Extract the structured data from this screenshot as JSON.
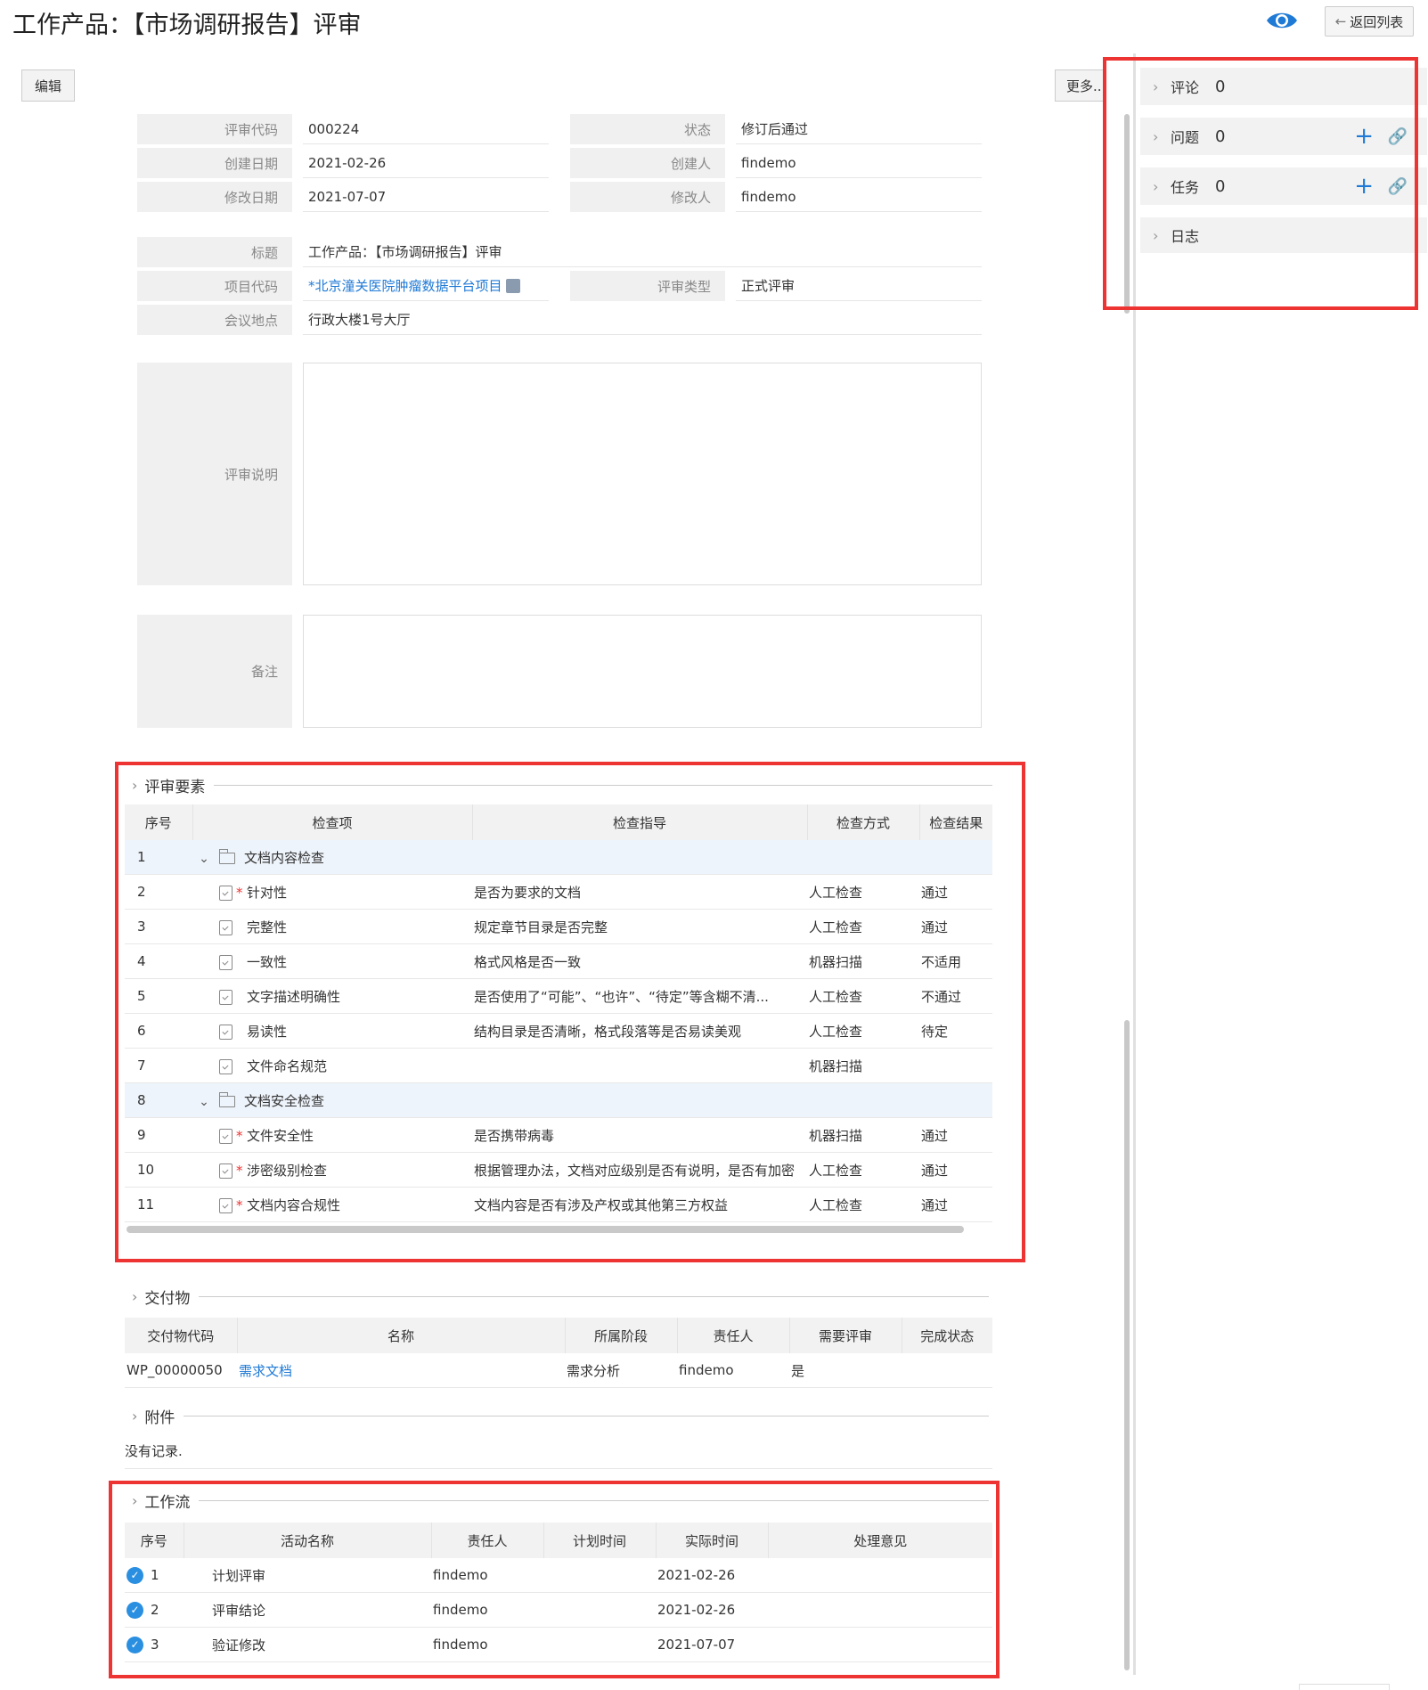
{
  "page_title": "工作产品：【市场调研报告】评审",
  "header": {
    "back_label": "返回列表",
    "eye_icon": "eye-icon"
  },
  "toolbar": {
    "edit_label": "编辑",
    "more_label": "更多..."
  },
  "form": {
    "review_code_label": "评审代码",
    "review_code": "000224",
    "status_label": "状态",
    "status": "修订后通过",
    "created_date_label": "创建日期",
    "created_date": "2021-02-26",
    "creator_label": "创建人",
    "creator": "findemo",
    "modified_date_label": "修改日期",
    "modified_date": "2021-07-07",
    "modifier_label": "修改人",
    "modifier": "findemo",
    "title_label": "标题",
    "title": "工作产品：【市场调研报告】评审",
    "project_code_label": "项目代码",
    "project_code": "*北京潼关医院肿瘤数据平台项目",
    "review_type_label": "评审类型",
    "review_type": "正式评审",
    "location_label": "会议地点",
    "location": "行政大楼1号大厅",
    "description_label": "评审说明",
    "description": "",
    "remark_label": "备注",
    "remark": ""
  },
  "review_elements": {
    "section_title": "评审要素",
    "headers": [
      "序号",
      "检查项",
      "检查指导",
      "检查方式",
      "检查结果"
    ],
    "rows": [
      {
        "no": "1",
        "group": true,
        "item": "文档内容检查",
        "required": false,
        "guide": "",
        "method": "",
        "result": ""
      },
      {
        "no": "2",
        "group": false,
        "item": "针对性",
        "required": true,
        "guide": "是否为要求的文档",
        "method": "人工检查",
        "result": "通过"
      },
      {
        "no": "3",
        "group": false,
        "item": "完整性",
        "required": false,
        "guide": "规定章节目录是否完整",
        "method": "人工检查",
        "result": "通过"
      },
      {
        "no": "4",
        "group": false,
        "item": "一致性",
        "required": false,
        "guide": "格式风格是否一致",
        "method": "机器扫描",
        "result": "不适用"
      },
      {
        "no": "5",
        "group": false,
        "item": "文字描述明确性",
        "required": false,
        "guide": "是否使用了“可能”、“也许”、“待定”等含糊不清...",
        "method": "人工检查",
        "result": "不通过"
      },
      {
        "no": "6",
        "group": false,
        "item": "易读性",
        "required": false,
        "guide": "结构目录是否清晰，格式段落等是否易读美观",
        "method": "人工检查",
        "result": "待定"
      },
      {
        "no": "7",
        "group": false,
        "item": "文件命名规范",
        "required": false,
        "guide": "",
        "method": "机器扫描",
        "result": ""
      },
      {
        "no": "8",
        "group": true,
        "item": "文档安全检查",
        "required": false,
        "guide": "",
        "method": "",
        "result": ""
      },
      {
        "no": "9",
        "group": false,
        "item": "文件安全性",
        "required": true,
        "guide": "是否携带病毒",
        "method": "机器扫描",
        "result": "通过"
      },
      {
        "no": "10",
        "group": false,
        "item": "涉密级别检查",
        "required": true,
        "guide": "根据管理办法，文档对应级别是否有说明，是否有加密",
        "method": "人工检查",
        "result": "通过"
      },
      {
        "no": "11",
        "group": false,
        "item": "文档内容合规性",
        "required": true,
        "guide": "文档内容是否有涉及产权或其他第三方权益",
        "method": "人工检查",
        "result": "通过"
      }
    ]
  },
  "deliverables": {
    "section_title": "交付物",
    "headers": [
      "交付物代码",
      "名称",
      "所属阶段",
      "责任人",
      "需要评审",
      "完成状态"
    ],
    "rows": [
      {
        "code": "WP_00000050",
        "name": "需求文档",
        "stage": "需求分析",
        "owner": "findemo",
        "need_review": "是",
        "status": ""
      }
    ]
  },
  "attachments": {
    "section_title": "附件",
    "empty_text": "没有记录."
  },
  "workflow": {
    "section_title": "工作流",
    "headers": [
      "序号",
      "活动名称",
      "责任人",
      "计划时间",
      "实际时间",
      "处理意见"
    ],
    "rows": [
      {
        "no": "1",
        "activity": "计划评审",
        "owner": "findemo",
        "planned": "",
        "actual": "2021-02-26",
        "comment": ""
      },
      {
        "no": "2",
        "activity": "评审结论",
        "owner": "findemo",
        "planned": "",
        "actual": "2021-02-26",
        "comment": ""
      },
      {
        "no": "3",
        "activity": "验证修改",
        "owner": "findemo",
        "planned": "",
        "actual": "2021-07-07",
        "comment": ""
      }
    ]
  },
  "side_panel": {
    "comments_label": "评论",
    "comments_count": "0",
    "issues_label": "问题",
    "issues_count": "0",
    "tasks_label": "任务",
    "tasks_count": "0",
    "log_label": "日志"
  },
  "colors": {
    "accent": "#1f7ad6",
    "highlight_border": "#ee3333",
    "group_row_bg": "#eef4fb"
  }
}
